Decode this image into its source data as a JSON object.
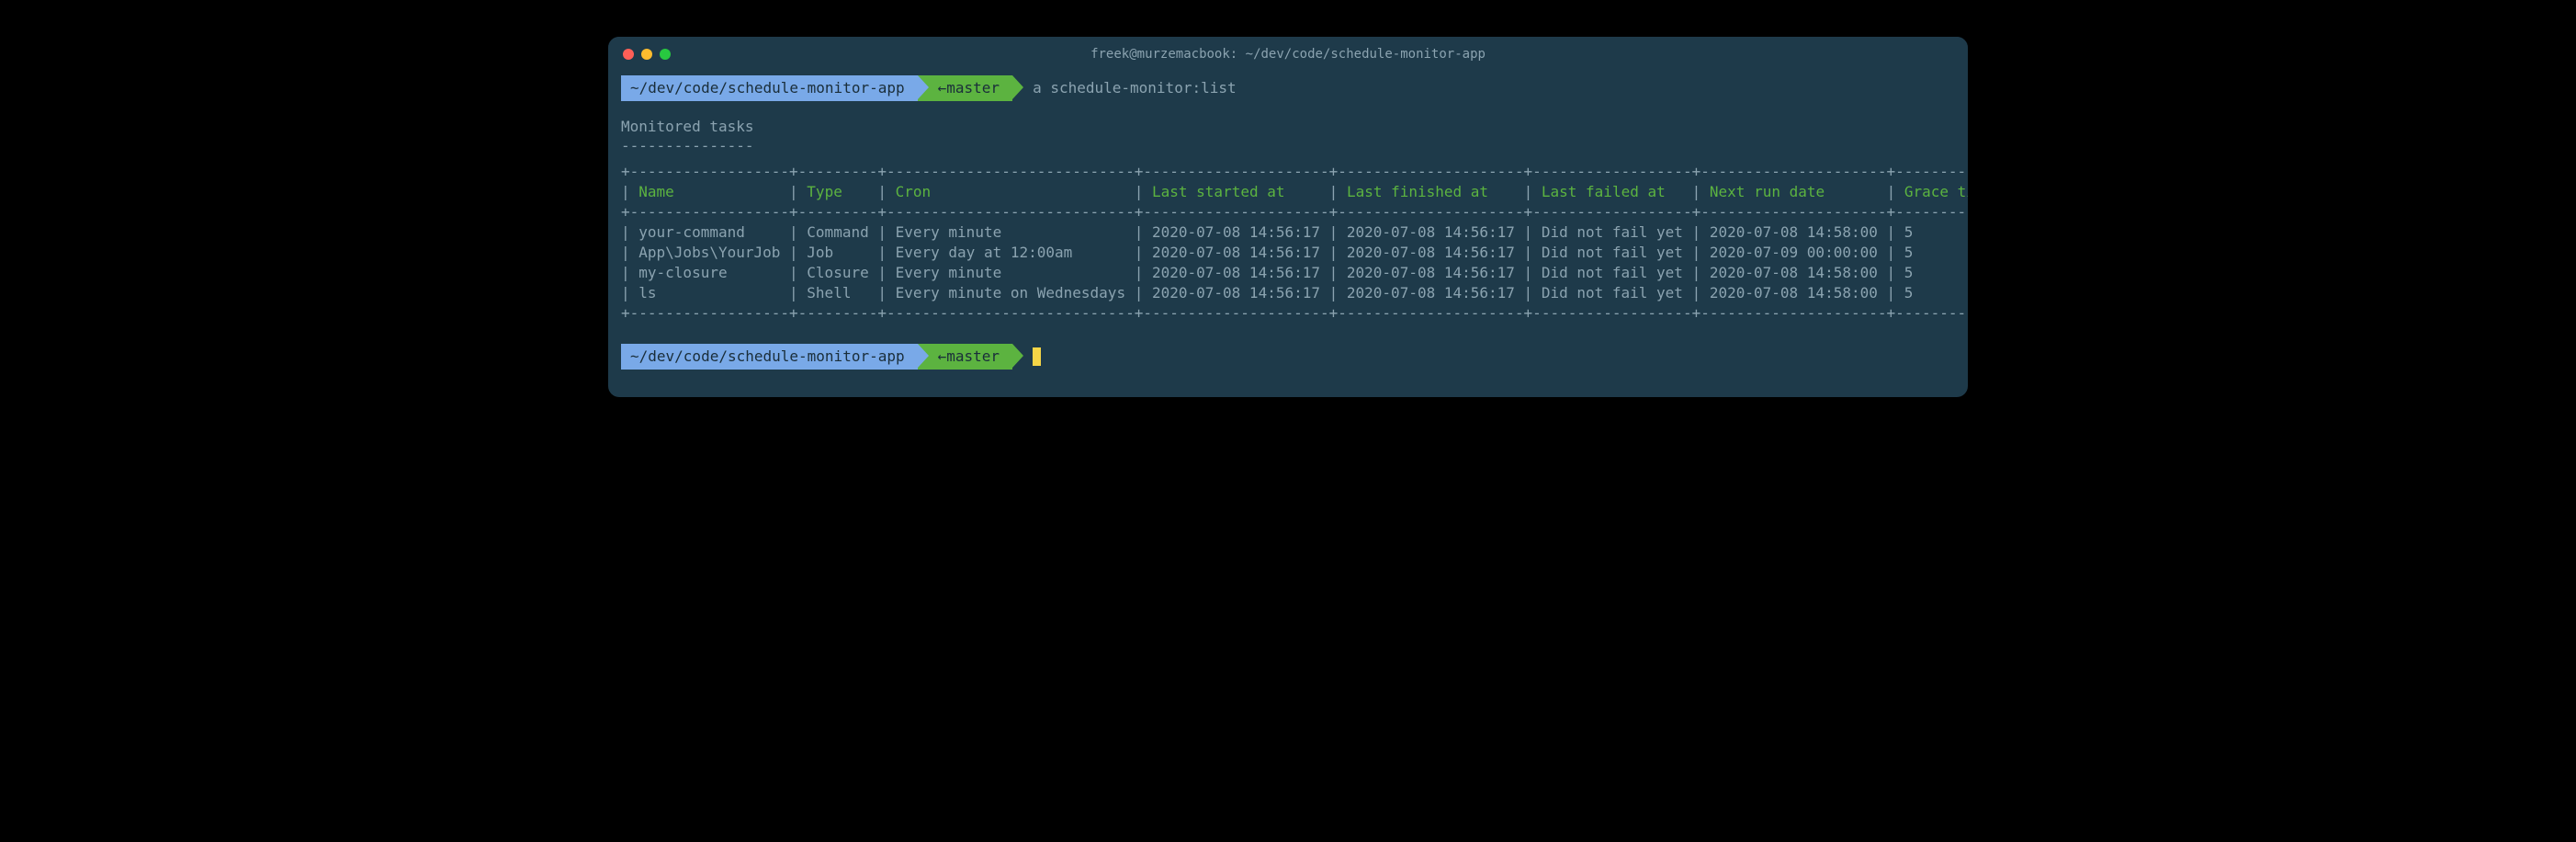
{
  "window": {
    "title": "freek@murzemacbook: ~/dev/code/schedule-monitor-app"
  },
  "prompt1": {
    "path": "~/dev/code/schedule-monitor-app",
    "branch": "←master",
    "command": "a schedule-monitor:list"
  },
  "output": {
    "title": "Monitored tasks",
    "underline": "---------------",
    "table": {
      "border_top": "+------------------+---------+----------------------------+---------------------+---------------------+------------------+---------------------+------------+",
      "border_mid": "+------------------+---------+----------------------------+---------------------+---------------------+------------------+---------------------+------------+",
      "border_bottom": "+------------------+---------+----------------------------+---------------------+---------------------+------------------+---------------------+------------+",
      "headers": {
        "name": "Name",
        "type": "Type",
        "cron": "Cron",
        "last_started": "Last started at",
        "last_finished": "Last finished at",
        "last_failed": "Last failed at",
        "next_run": "Next run date",
        "grace": "Grace time"
      },
      "rows": [
        {
          "name": "your-command",
          "type": "Command",
          "cron": "Every minute",
          "last_started": "2020-07-08 14:56:17",
          "last_finished": "2020-07-08 14:56:17",
          "last_failed": "Did not fail yet",
          "next_run": "2020-07-08 14:58:00",
          "grace": "5"
        },
        {
          "name": "App\\Jobs\\YourJob",
          "type": "Job",
          "cron": "Every day at 12:00am",
          "last_started": "2020-07-08 14:56:17",
          "last_finished": "2020-07-08 14:56:17",
          "last_failed": "Did not fail yet",
          "next_run": "2020-07-09 00:00:00",
          "grace": "5"
        },
        {
          "name": "my-closure",
          "type": "Closure",
          "cron": "Every minute",
          "last_started": "2020-07-08 14:56:17",
          "last_finished": "2020-07-08 14:56:17",
          "last_failed": "Did not fail yet",
          "next_run": "2020-07-08 14:58:00",
          "grace": "5"
        },
        {
          "name": "ls",
          "type": "Shell",
          "cron": "Every minute on Wednesdays",
          "last_started": "2020-07-08 14:56:17",
          "last_finished": "2020-07-08 14:56:17",
          "last_failed": "Did not fail yet",
          "next_run": "2020-07-08 14:58:00",
          "grace": "5"
        }
      ]
    }
  },
  "prompt2": {
    "path": "~/dev/code/schedule-monitor-app",
    "branch": "←master"
  },
  "col_widths": {
    "name": 16,
    "type": 7,
    "cron": 26,
    "last_started": 19,
    "last_finished": 19,
    "last_failed": 16,
    "next_run": 19,
    "grace": 10
  }
}
